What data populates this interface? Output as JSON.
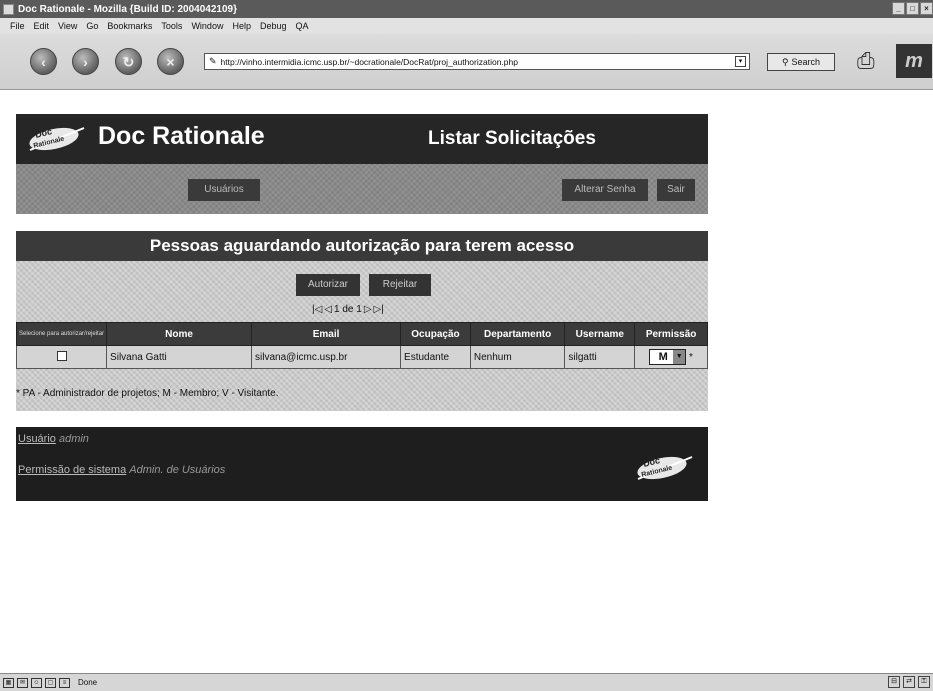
{
  "window": {
    "title": "Doc Rationale - Mozilla {Build ID: 2004042109}"
  },
  "menu": [
    "File",
    "Edit",
    "View",
    "Go",
    "Bookmarks",
    "Tools",
    "Window",
    "Help",
    "Debug",
    "QA"
  ],
  "toolbar": {
    "url": "http://vinho.intermidia.icmc.usp.br/~docrationale/DocRat/proj_authorization.php",
    "search_label": "Search"
  },
  "header": {
    "site_name": "Doc Rationale",
    "page_heading": "Listar Solicitações",
    "logo_text": "Doc Rationale"
  },
  "nav": {
    "users": "Usuários",
    "change_password": "Alterar Senha",
    "logout": "Sair"
  },
  "panel": {
    "title": "Pessoas aguardando autorização para terem acesso",
    "authorize": "Autorizar",
    "reject": "Rejeitar",
    "pager_text": "1 de 1"
  },
  "table": {
    "headers": {
      "select": "Selecione para autorizar/rejeitar",
      "name": "Nome",
      "email": "Email",
      "occupation": "Ocupação",
      "department": "Departamento",
      "username": "Username",
      "permission": "Permissão"
    },
    "rows": [
      {
        "name": "Silvana Gatti",
        "email": "silvana@icmc.usp.br",
        "occupation": "Estudante",
        "department": "Nenhum",
        "username": "silgatti",
        "permission": "M",
        "marker": "*"
      }
    ]
  },
  "footnote": "* PA - Administrador de projetos; M - Membro; V - Visitante.",
  "footer": {
    "user_label": "Usuário",
    "user_value": "admin",
    "perm_label": "Permissão de sistema",
    "perm_value": "Admin. de Usuários"
  },
  "status": {
    "text": "Done"
  }
}
